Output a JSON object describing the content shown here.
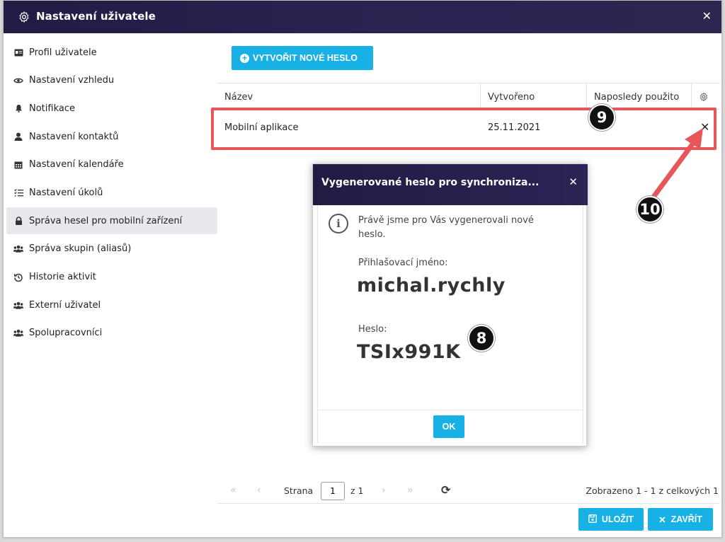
{
  "window": {
    "title": "Nastavení uživatele"
  },
  "sidebar": {
    "items": [
      {
        "label": "Profil uživatele",
        "icon": "id-card-icon"
      },
      {
        "label": "Nastavení vzhledu",
        "icon": "eye-icon"
      },
      {
        "label": "Notifikace",
        "icon": "bell-icon"
      },
      {
        "label": "Nastavení kontaktů",
        "icon": "user-icon"
      },
      {
        "label": "Nastavení kalendáře",
        "icon": "calendar-icon"
      },
      {
        "label": "Nastavení úkolů",
        "icon": "tasks-icon"
      },
      {
        "label": "Správa hesel pro mobilní zařízení",
        "icon": "lock-icon",
        "active": true
      },
      {
        "label": "Správa skupin (aliasů)",
        "icon": "users-icon"
      },
      {
        "label": "Historie aktivit",
        "icon": "history-icon"
      },
      {
        "label": "Externí uživatel",
        "icon": "users-icon"
      },
      {
        "label": "Spolupracovníci",
        "icon": "users-icon"
      }
    ]
  },
  "main": {
    "create_label": "VYTVOŘIT NOVÉ HESLO",
    "columns": [
      "Název",
      "Vytvořeno",
      "Naposledy použito"
    ],
    "rows": [
      {
        "name": "Mobilní aplikace",
        "created": "25.11.2021",
        "last_used": ""
      }
    ]
  },
  "annotations": {
    "badge_9": "9",
    "badge_10": "10",
    "badge_8": "8"
  },
  "modal": {
    "title": "Vygenerované heslo pro synchroniza...",
    "info": "Právě jsme pro Vás vygenerovali nové heslo.",
    "login_label": "Přihlašovací jméno:",
    "login_value": "michal.rychly",
    "password_label": "Heslo:",
    "password_value": "TSIx991K",
    "ok_label": "OK"
  },
  "pager": {
    "page_label": "Strana",
    "page_value": "1",
    "of_label": "z 1",
    "summary": "Zobrazeno 1 - 1 z celkových 1"
  },
  "footer": {
    "save_label": "ULOŽIT",
    "close_label": "ZAVŘÍT"
  },
  "colors": {
    "accent": "#17b1e6",
    "header": "#201c44",
    "highlight": "#e8565a"
  }
}
